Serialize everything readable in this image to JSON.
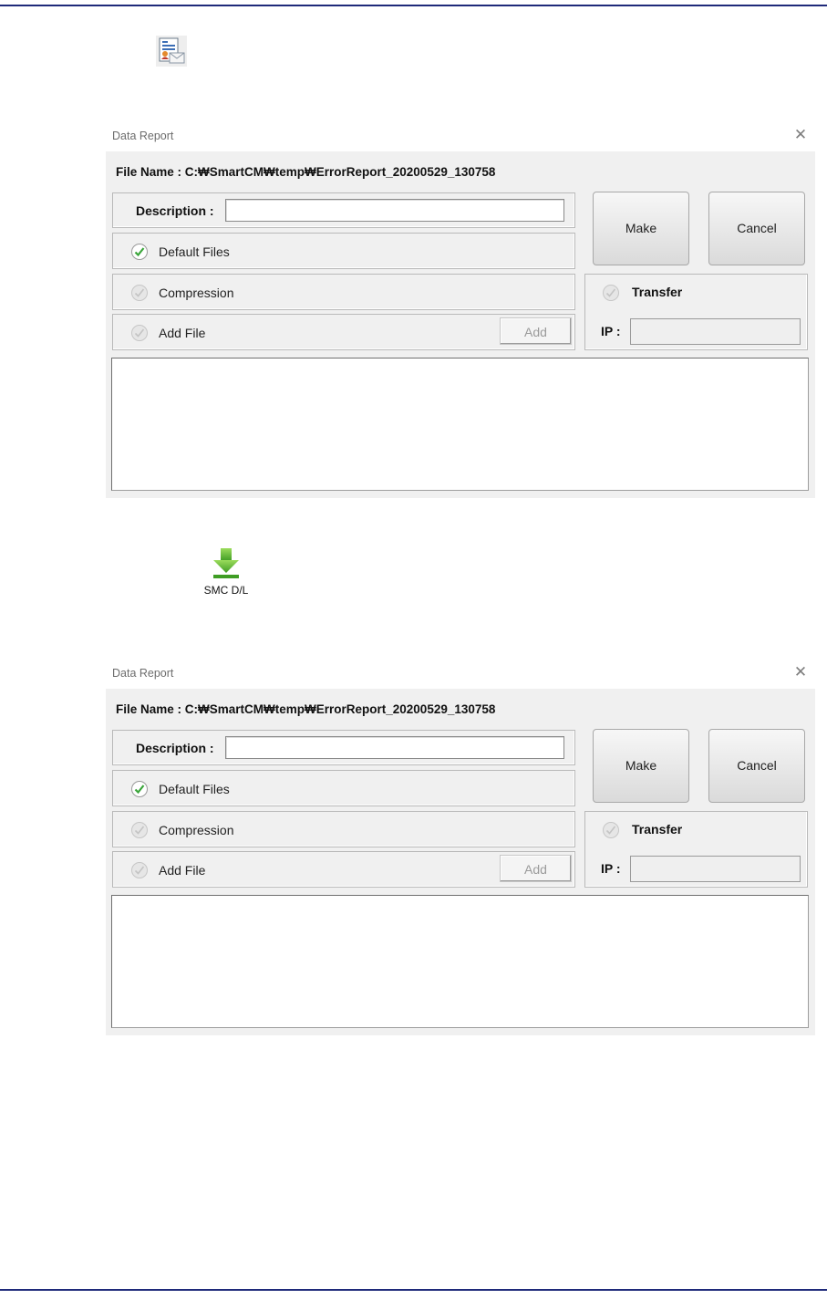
{
  "toolbar": {
    "report_icon": "data-report-icon",
    "smc_icon": "green-download-arrow-icon",
    "smc_label": "SMC D/L"
  },
  "dialogs": [
    {
      "title": "Data Report",
      "close_glyph": "✕",
      "file_name": "File Name : C:₩SmartCM₩temp₩ErrorReport_20200529_130758",
      "description_label": "Description :",
      "description_value": "",
      "default_files_label": "Default Files",
      "default_files_checked": true,
      "compression_label": "Compression",
      "compression_checked": false,
      "add_file_label": "Add File",
      "add_file_checked": false,
      "add_button": "Add",
      "make_button": "Make",
      "cancel_button": "Cancel",
      "transfer_label": "Transfer",
      "transfer_checked": false,
      "ip_label": "IP :",
      "ip_value": ""
    },
    {
      "title": "Data Report",
      "close_glyph": "✕",
      "file_name": "File Name : C:₩SmartCM₩temp₩ErrorReport_20200529_130758",
      "description_label": "Description :",
      "description_value": "",
      "default_files_label": "Default Files",
      "default_files_checked": true,
      "compression_label": "Compression",
      "compression_checked": false,
      "add_file_label": "Add File",
      "add_file_checked": false,
      "add_button": "Add",
      "make_button": "Make",
      "cancel_button": "Cancel",
      "transfer_label": "Transfer",
      "transfer_checked": false,
      "ip_label": "IP :",
      "ip_value": ""
    }
  ],
  "colors": {
    "rule": "#1f2a7a",
    "check_green": "#3aa53a",
    "dialog_bg": "#f0f0f0",
    "download_green": "#6cc23c"
  }
}
